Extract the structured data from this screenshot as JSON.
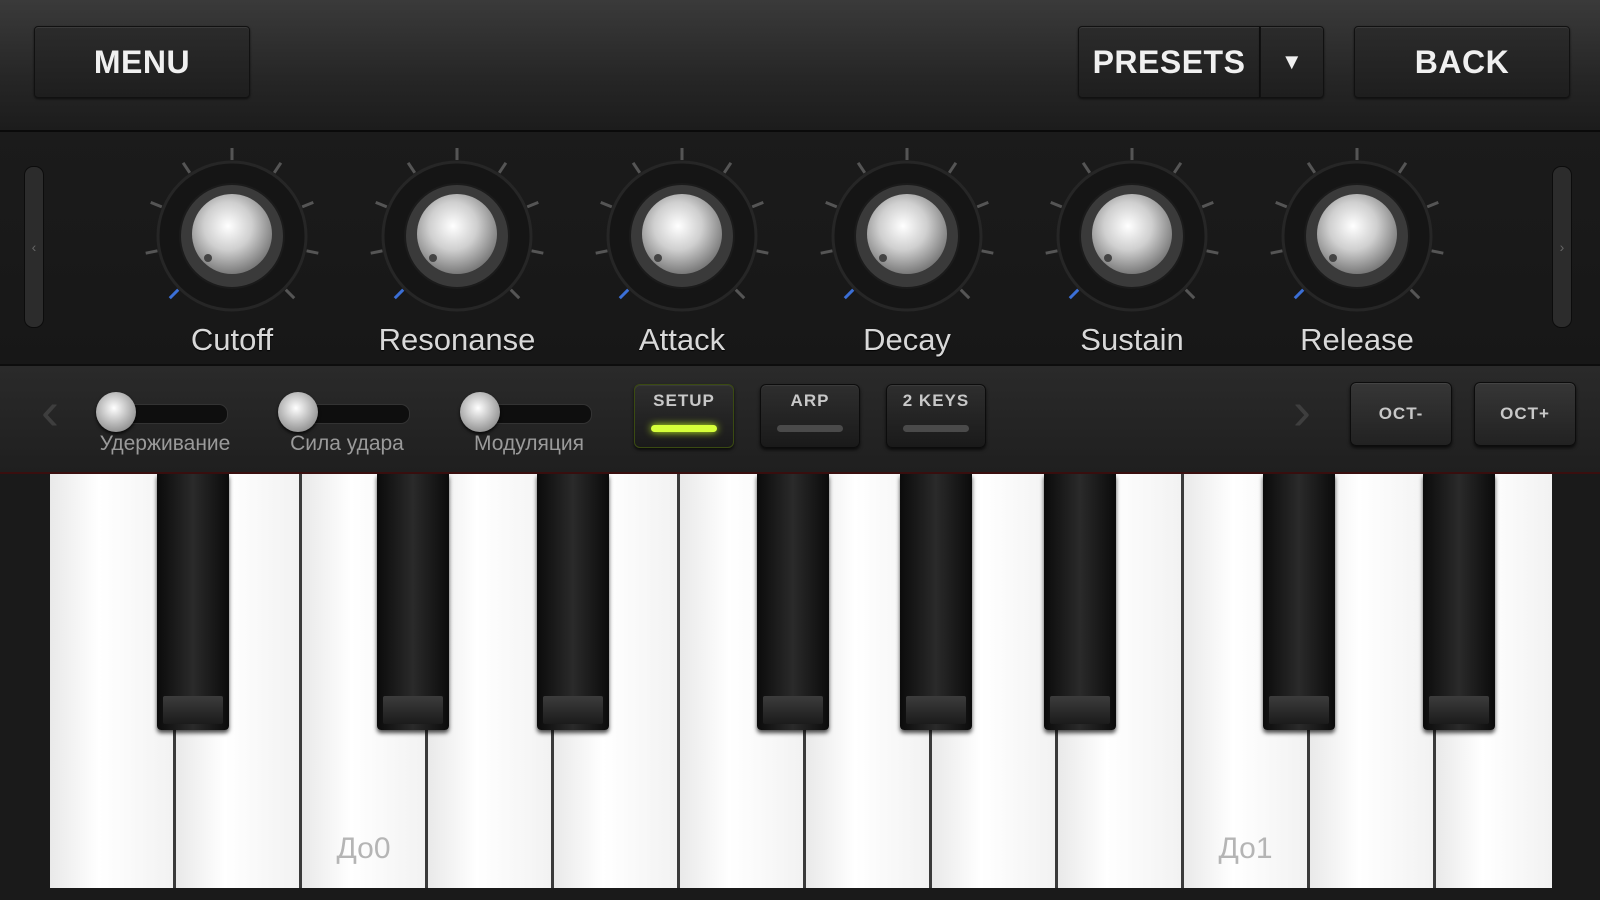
{
  "topbar": {
    "menu_label": "MENU",
    "presets_label": "PRESETS",
    "presets_dropdown_icon": "▼",
    "back_label": "BACK"
  },
  "knobs": [
    {
      "label": "Cutoff"
    },
    {
      "label": "Resonanse"
    },
    {
      "label": "Attack"
    },
    {
      "label": "Decay"
    },
    {
      "label": "Sustain"
    },
    {
      "label": "Release"
    }
  ],
  "side_slots": {
    "left_icon": "‹",
    "right_icon": "›"
  },
  "controls": {
    "prev_arrow": "‹",
    "next_arrow": "›",
    "sliders": [
      {
        "label": "Удерживание"
      },
      {
        "label": "Сила удара"
      },
      {
        "label": "Модуляция"
      }
    ],
    "modes": [
      {
        "label": "SETUP",
        "active": true
      },
      {
        "label": "ARP",
        "active": false
      },
      {
        "label": "2 KEYS",
        "active": false
      }
    ],
    "oct_down": "OCT-",
    "oct_up": "OCT+"
  },
  "keyboard": {
    "octave_labels": [
      "До0",
      "До1"
    ]
  },
  "colors": {
    "led_active": "#d6ff3a",
    "panel": "#1b1b1b"
  }
}
